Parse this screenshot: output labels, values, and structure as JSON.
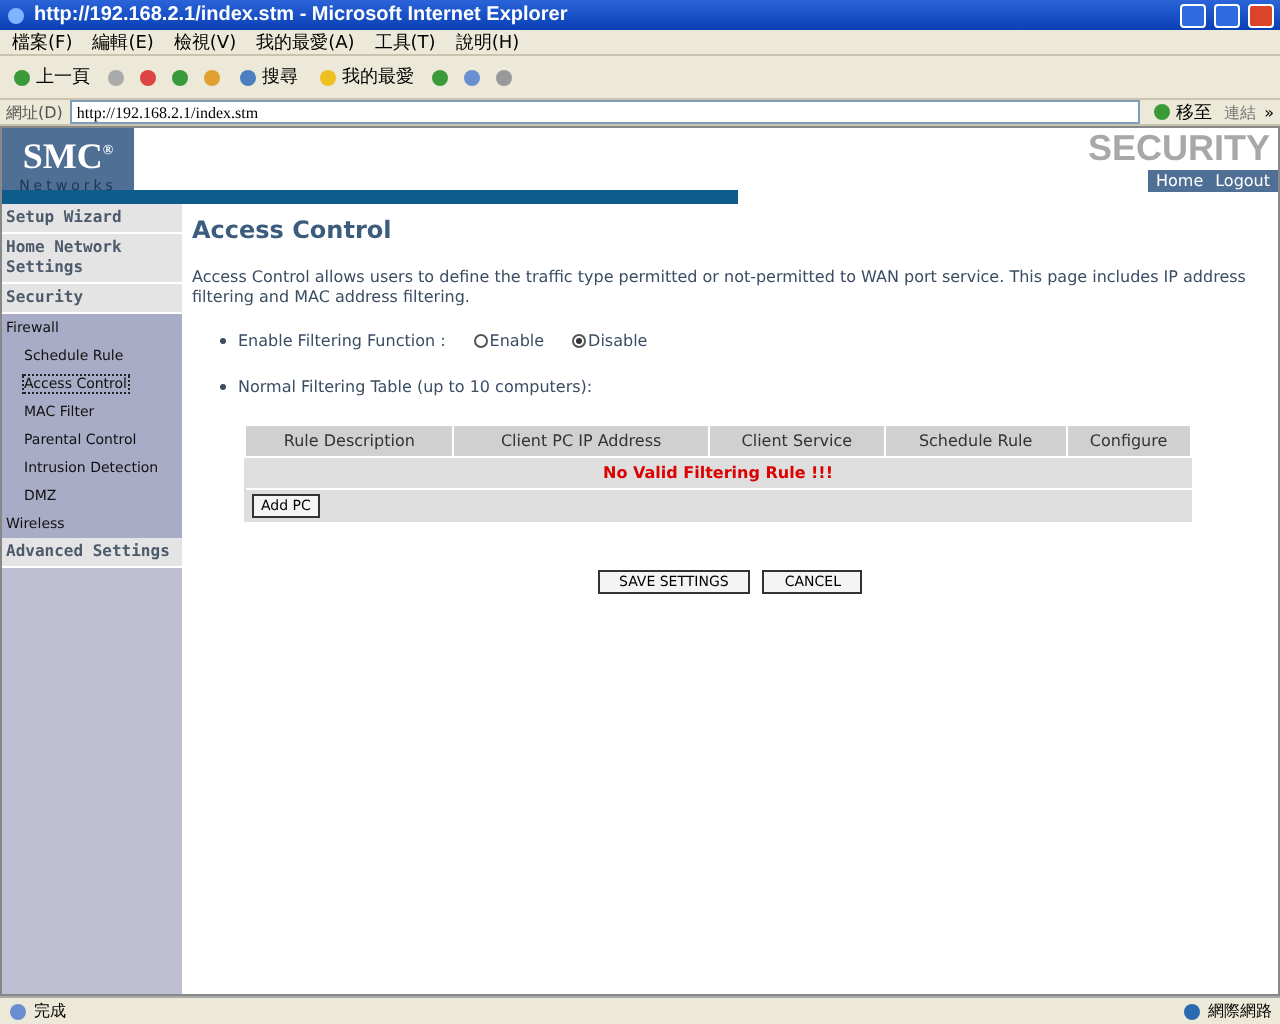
{
  "window": {
    "title": "http://192.168.2.1/index.stm - Microsoft Internet Explorer"
  },
  "menu": [
    "檔案(F)",
    "編輯(E)",
    "檢視(V)",
    "我的最愛(A)",
    "工具(T)",
    "說明(H)"
  ],
  "toolbar": {
    "back": "上一頁",
    "search": "搜尋",
    "favorites": "我的最愛"
  },
  "address_bar": {
    "label": "網址(D)",
    "value": "http://192.168.2.1/index.stm",
    "go": "移至",
    "links": "連結",
    "more": "»"
  },
  "header": {
    "logo": "SMC",
    "registered": "®",
    "tagline": "Networks",
    "product": "SECURITY",
    "home": "Home",
    "logout": "Logout"
  },
  "sidebar": [
    {
      "label": "Setup Wizard",
      "kind": "section"
    },
    {
      "label": "Home Network Settings",
      "kind": "section"
    },
    {
      "label": "Security",
      "kind": "section"
    },
    {
      "label": "Firewall",
      "kind": "group"
    },
    {
      "label": "Schedule Rule",
      "kind": "item",
      "selected": false
    },
    {
      "label": "Access Control",
      "kind": "item",
      "selected": true
    },
    {
      "label": "MAC Filter",
      "kind": "item",
      "selected": false
    },
    {
      "label": "Parental Control",
      "kind": "item",
      "selected": false
    },
    {
      "label": "Intrusion Detection",
      "kind": "item",
      "selected": false
    },
    {
      "label": "DMZ",
      "kind": "item",
      "selected": false
    },
    {
      "label": "Wireless",
      "kind": "group"
    },
    {
      "label": "Advanced Settings",
      "kind": "section"
    }
  ],
  "content": {
    "title": "Access Control",
    "description": "Access Control allows users to define the traffic type permitted or not-permitted to WAN port service. This page includes IP address filtering and MAC address filtering.",
    "filter_label": "Enable Filtering Function :",
    "filter_options": [
      {
        "label": "Enable",
        "selected": false
      },
      {
        "label": "Disable",
        "selected": true
      }
    ],
    "table_label": "Normal Filtering Table (up to 10 computers):",
    "table": {
      "columns": [
        "Rule Description",
        "Client PC IP Address",
        "Client Service",
        "Schedule Rule",
        "Configure"
      ],
      "empty_message": "No Valid Filtering Rule !!!",
      "add_button": "Add PC"
    },
    "buttons": [
      "SAVE SETTINGS",
      "CANCEL"
    ]
  },
  "status_bar": {
    "status": "完成",
    "zone": "網際網路"
  }
}
